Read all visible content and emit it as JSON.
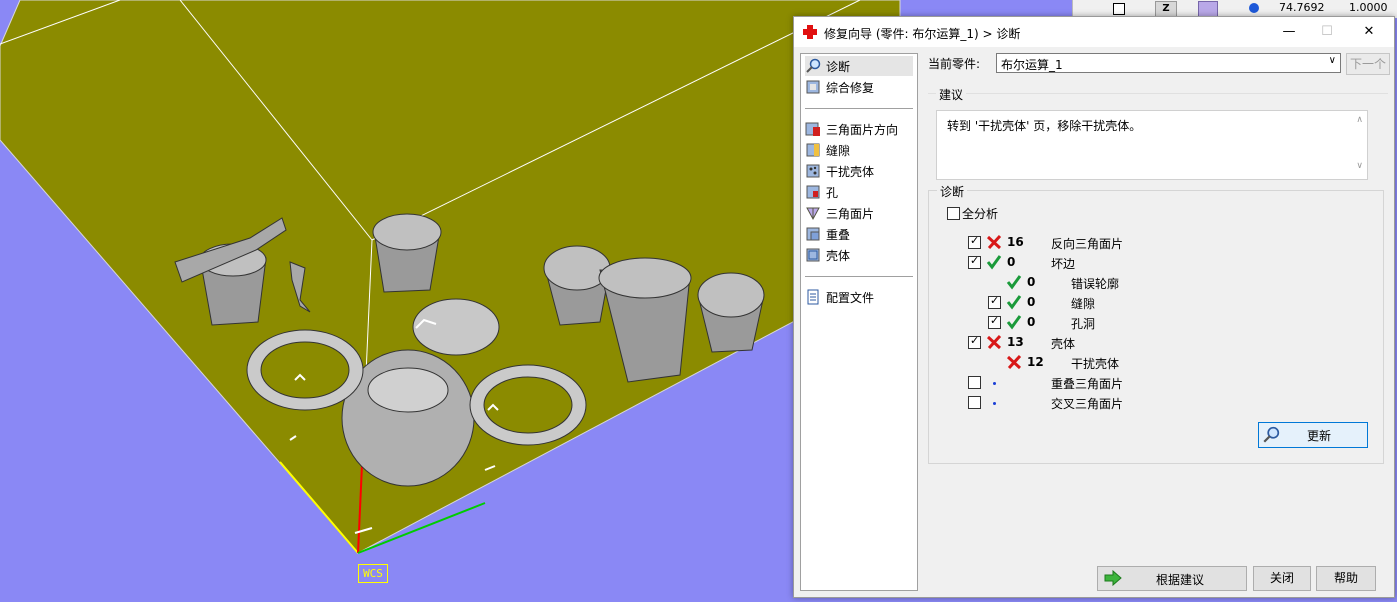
{
  "viewport": {
    "wcs_label": "WCS",
    "colors": {
      "background": "#8a88f5",
      "platform": "#8b8b00",
      "x_axis": "#ff0000",
      "y_axis": "#00cc00",
      "z_axis": "#ffff00"
    }
  },
  "toolbar": {
    "axis_button": "Z",
    "value_1": "74.7692",
    "value_2": "1.0000"
  },
  "dialog": {
    "title": "修复向导 (零件: 布尔运算_1) > 诊断",
    "window_controls": {
      "minimize": "—",
      "maximize": "☐",
      "close": "✕"
    },
    "sidebar": {
      "group1": [
        {
          "label": "诊断",
          "icon": "magnifier-icon",
          "selected": true
        },
        {
          "label": "综合修复",
          "icon": "composite-repair-icon"
        }
      ],
      "group2": [
        {
          "label": "三角面片方向",
          "icon": "triangle-orientation-icon"
        },
        {
          "label": "缝隙",
          "icon": "gap-icon"
        },
        {
          "label": "干扰壳体",
          "icon": "noise-shell-icon"
        },
        {
          "label": "孔",
          "icon": "hole-icon"
        },
        {
          "label": "三角面片",
          "icon": "triangle-icon"
        },
        {
          "label": "重叠",
          "icon": "overlap-icon"
        },
        {
          "label": "壳体",
          "icon": "shell-icon"
        }
      ],
      "group3": [
        {
          "label": "配置文件",
          "icon": "profile-document-icon"
        }
      ]
    },
    "current_part_label": "当前零件:",
    "current_part_value": "布尔运算_1",
    "next_button": "下一个",
    "suggestion": {
      "title": "建议",
      "text": "转到 '干扰壳体' 页，移除干扰壳体。"
    },
    "diagnosis": {
      "title": "诊断",
      "full_analysis_label": "全分析",
      "full_analysis_checked": false,
      "rows": [
        {
          "checked": true,
          "status": "error",
          "count": "16",
          "label": "反向三角面片"
        },
        {
          "checked": true,
          "status": "ok",
          "count": "0",
          "label": "坏边"
        },
        {
          "checkbox": false,
          "status": "ok",
          "count": "0",
          "label": "错误轮廓"
        },
        {
          "checked": true,
          "status": "ok",
          "count": "0",
          "label": "缝隙"
        },
        {
          "checked": true,
          "status": "ok",
          "count": "0",
          "label": "孔洞"
        },
        {
          "checked": true,
          "status": "error",
          "count": "13",
          "label": "壳体"
        },
        {
          "checkbox": false,
          "status": "error",
          "count": "12",
          "label": "干扰壳体"
        },
        {
          "checked": false,
          "status": "none",
          "count": "",
          "label": "重叠三角面片"
        },
        {
          "checked": false,
          "status": "none",
          "count": "",
          "label": "交叉三角面片"
        }
      ],
      "update_button": "更新"
    },
    "footer": {
      "apply_button": "根据建议",
      "close_button": "关闭",
      "help_button": "帮助"
    }
  }
}
